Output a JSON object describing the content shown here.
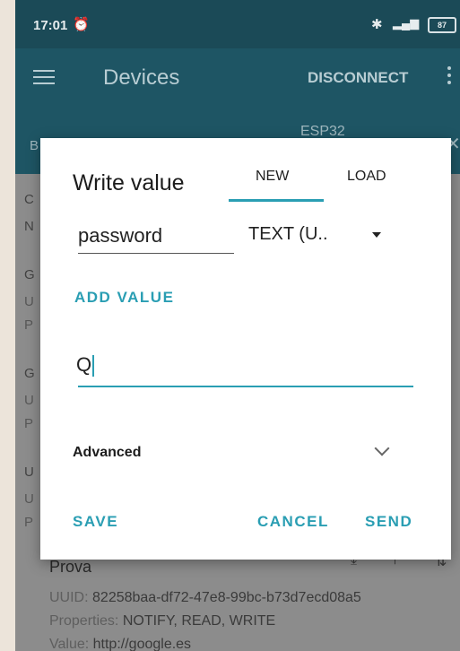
{
  "status_bar": {
    "time": "17:01",
    "alarm_icon": "alarm-off-icon",
    "bluetooth_icon": "bluetooth-icon",
    "signal_icon": "signal-icon",
    "battery": "87"
  },
  "app_bar": {
    "title": "Devices",
    "disconnect_label": "DISCONNECT"
  },
  "tab_bar": {
    "device_name": "ESP32",
    "left_letter": "B"
  },
  "background": {
    "letters": [
      "C",
      "N",
      "G",
      "U",
      "P",
      "G",
      "U",
      "P",
      "U",
      "U",
      "P"
    ],
    "characteristic": {
      "name": "Prova",
      "uuid_label": "UUID:",
      "uuid": "82258baa-df72-47e8-99bc-b73d7ecd08a5",
      "properties_label": "Properties:",
      "properties": "NOTIFY, READ, WRITE",
      "value_label": "Value:",
      "value": "http://google.es"
    }
  },
  "dialog": {
    "title": "Write value",
    "tabs": {
      "new": "NEW",
      "load": "LOAD"
    },
    "name_value": "password",
    "type_value": "TEXT (U..",
    "add_value_label": "ADD VALUE",
    "input_value": "Q",
    "advanced_label": "Advanced",
    "buttons": {
      "save": "SAVE",
      "cancel": "CANCEL",
      "send": "SEND"
    }
  },
  "colors": {
    "accent": "#2a9eb3",
    "app_bar": "#1e5564",
    "status_bar": "#1b4a57"
  }
}
